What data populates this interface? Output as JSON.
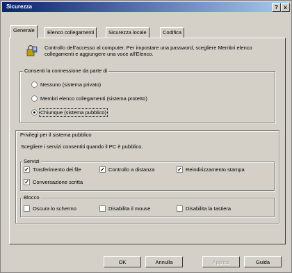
{
  "window": {
    "title": "Sicurezza",
    "help_glyph": "?",
    "close_glyph": "x"
  },
  "tabs": [
    {
      "label": "Generale",
      "active": true
    },
    {
      "label": "Elenco collegamenti",
      "active": false
    },
    {
      "label": "Sicurezza locale",
      "active": false
    },
    {
      "label": "Codifica",
      "active": false
    }
  ],
  "intro": "Controllo dell'accesso al computer. Per impostare una password, scegliere Membri elenco collegamenti e aggiungere una voce all'Elenco.",
  "connection_group": {
    "label": "Consenti la connessione da parte di",
    "options": [
      {
        "label": "Nessuno (sistema privato)",
        "selected": false
      },
      {
        "label": "Membri elenco collegamenti (sistema protetto)",
        "selected": false
      },
      {
        "label": "Chiunque (sistema pubblico)",
        "selected": true
      }
    ]
  },
  "privileges_group": {
    "label": "Privilegi per il sistema pubblico",
    "description": "Scegliere i servizi consentiti quando il PC è pubblico.",
    "services": {
      "label": "Servizi",
      "items": [
        {
          "label": "Trasferimento dei file",
          "checked": true
        },
        {
          "label": "Controllo a distanza",
          "checked": true
        },
        {
          "label": "Reindirizzamento stampa",
          "checked": true
        },
        {
          "label": "Conversazione scritta",
          "checked": true
        }
      ]
    },
    "block": {
      "label": "Blocco",
      "items": [
        {
          "label": "Oscura lo schermo",
          "checked": false
        },
        {
          "label": "Disabilita il mouse",
          "checked": false
        },
        {
          "label": "Disabilita la tastiera",
          "checked": false
        }
      ]
    }
  },
  "buttons": {
    "ok": "OK",
    "cancel": "Annulla",
    "apply": "Applica",
    "help": "Guida"
  }
}
